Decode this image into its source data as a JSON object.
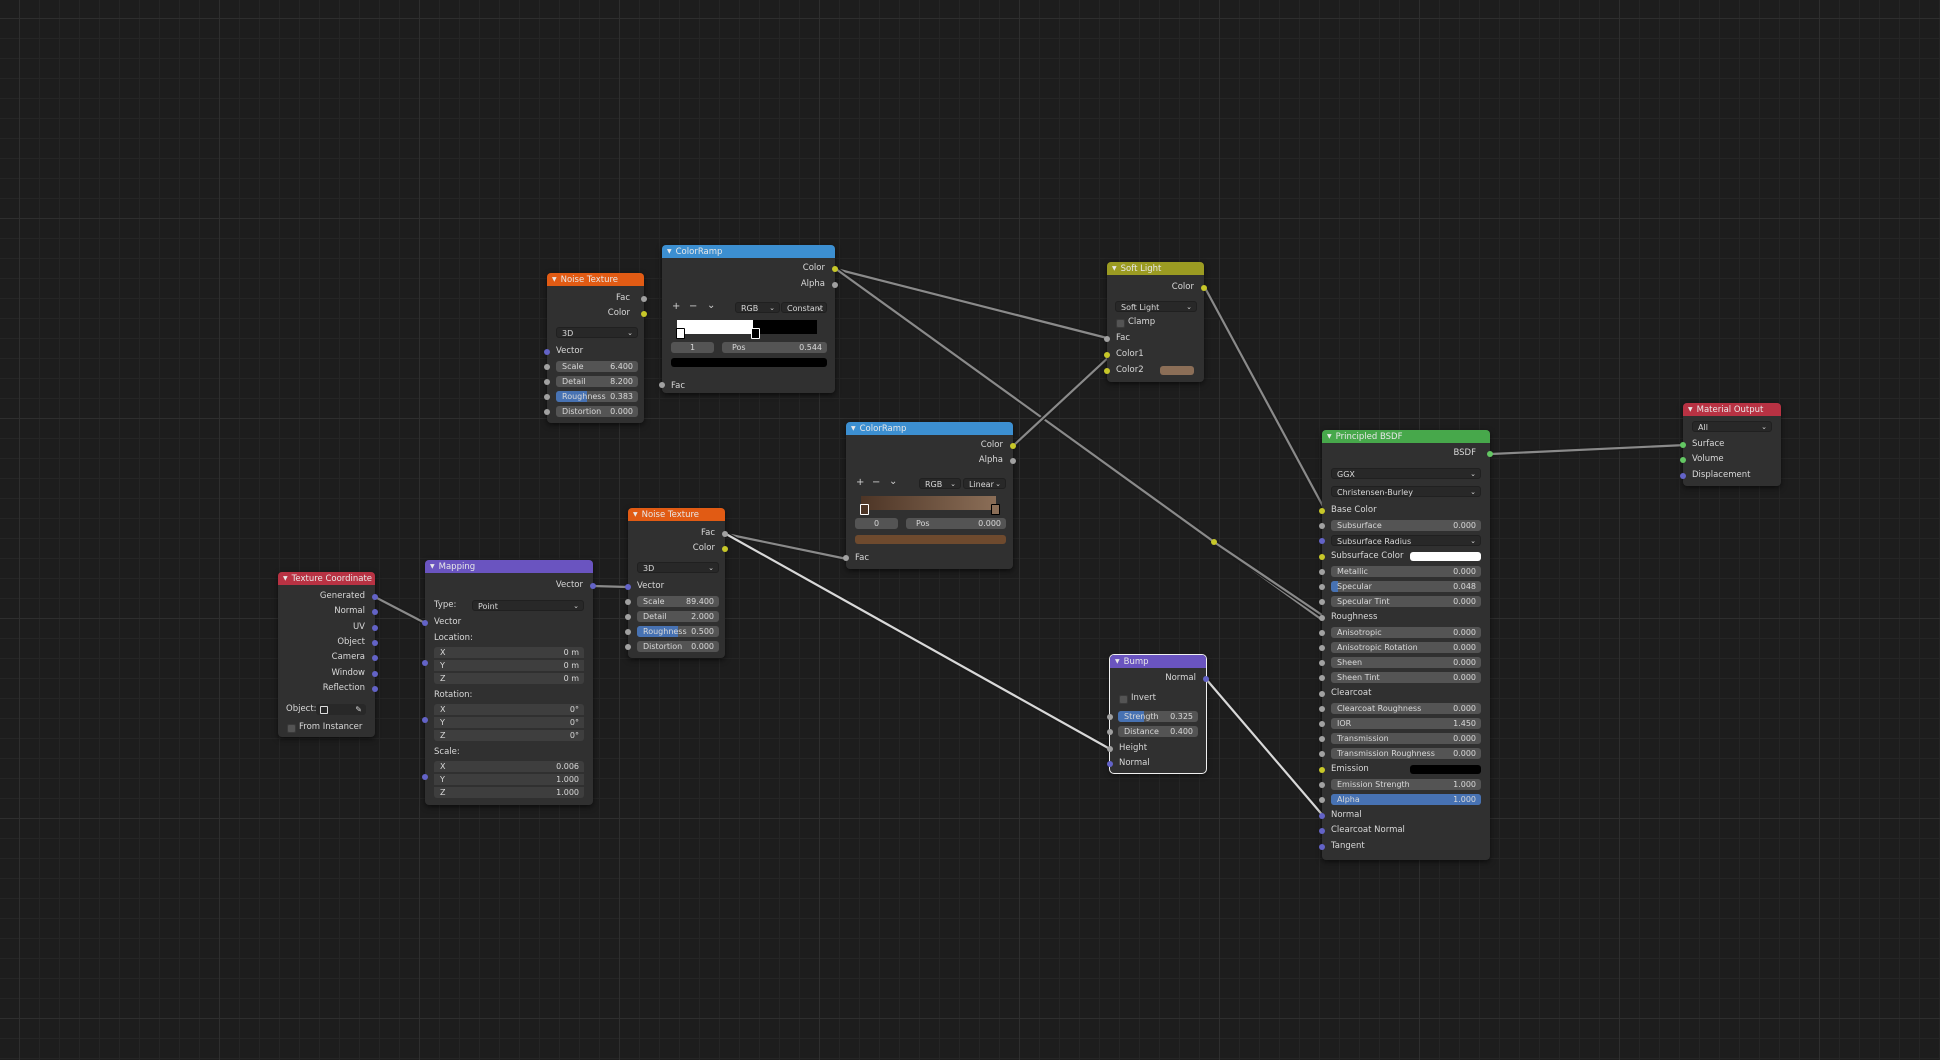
{
  "colors": {
    "header_texture": "#e15b14",
    "header_converter": "#3c8fd1",
    "header_vector": "#6a54c0",
    "header_input": "#b83243",
    "header_color": "#9b9b22",
    "header_shader": "#47a84b",
    "header_output": "#b83243",
    "accent": "#4772b3",
    "soft_light_color2": "#8b6e57",
    "ramp2_left": "#4d3526",
    "ramp2_right": "#8b6e57",
    "ramp2_output": "#6e4a2e"
  },
  "noise1": {
    "title": "Noise Texture",
    "out_fac": "Fac",
    "out_color": "Color",
    "dim": "3D",
    "in_vector": "Vector",
    "scale_label": "Scale",
    "scale_value": "6.400",
    "detail_label": "Detail",
    "detail_value": "8.200",
    "rough_label": "Roughness",
    "rough_value": "0.383",
    "rough_fill": 0.383,
    "dist_label": "Distortion",
    "dist_value": "0.000"
  },
  "ramp1": {
    "title": "ColorRamp",
    "out_color": "Color",
    "out_alpha": "Alpha",
    "add": "+",
    "remove": "−",
    "menu": "⌄",
    "mode": "RGB",
    "interp": "Constant",
    "index": "1",
    "pos_label": "Pos",
    "pos_value": "0.544",
    "in_fac": "Fac"
  },
  "ramp2": {
    "title": "ColorRamp",
    "out_color": "Color",
    "out_alpha": "Alpha",
    "add": "+",
    "remove": "−",
    "menu": "⌄",
    "mode": "RGB",
    "interp": "Linear",
    "index": "0",
    "pos_label": "Pos",
    "pos_value": "0.000",
    "in_fac": "Fac"
  },
  "noise2": {
    "title": "Noise Texture",
    "out_fac": "Fac",
    "out_color": "Color",
    "dim": "3D",
    "in_vector": "Vector",
    "scale_label": "Scale",
    "scale_value": "89.400",
    "detail_label": "Detail",
    "detail_value": "2.000",
    "rough_label": "Roughness",
    "rough_value": "0.500",
    "rough_fill": 0.5,
    "dist_label": "Distortion",
    "dist_value": "0.000"
  },
  "texcoord": {
    "title": "Texture Coordinate",
    "outputs": [
      "Generated",
      "Normal",
      "UV",
      "Object",
      "Camera",
      "Window",
      "Reflection"
    ],
    "object_label": "Object:",
    "from_instancer": "From Instancer"
  },
  "mapping": {
    "title": "Mapping",
    "out_vector": "Vector",
    "type_label": "Type:",
    "type_value": "Point",
    "in_vector": "Vector",
    "location_label": "Location:",
    "loc": [
      {
        "k": "X",
        "v": "0 m"
      },
      {
        "k": "Y",
        "v": "0 m"
      },
      {
        "k": "Z",
        "v": "0 m"
      }
    ],
    "rotation_label": "Rotation:",
    "rot": [
      {
        "k": "X",
        "v": "0°"
      },
      {
        "k": "Y",
        "v": "0°"
      },
      {
        "k": "Z",
        "v": "0°"
      }
    ],
    "scale_label": "Scale:",
    "scl": [
      {
        "k": "X",
        "v": "0.006"
      },
      {
        "k": "Y",
        "v": "1.000"
      },
      {
        "k": "Z",
        "v": "1.000"
      }
    ]
  },
  "softlight": {
    "title": "Soft Light",
    "out_color": "Color",
    "blend": "Soft Light",
    "clamp": "Clamp",
    "in_fac": "Fac",
    "in_color1": "Color1",
    "in_color2": "Color2"
  },
  "bump": {
    "title": "Bump",
    "out_normal": "Normal",
    "invert": "Invert",
    "strength_label": "Strength",
    "strength_value": "0.325",
    "strength_fill": 0.325,
    "distance_label": "Distance",
    "distance_value": "0.400",
    "in_height": "Height",
    "in_normal": "Normal"
  },
  "bsdf": {
    "title": "Principled BSDF",
    "out_bsdf": "BSDF",
    "distribution": "GGX",
    "subsurface_method": "Christensen-Burley",
    "base_color": "Base Color",
    "subsurface_label": "Subsurface",
    "subsurface_value": "0.000",
    "subsurface_radius": "Subsurface Radius",
    "subsurface_color": "Subsurface Color",
    "metallic_label": "Metallic",
    "metallic_value": "0.000",
    "specular_label": "Specular",
    "specular_value": "0.048",
    "specular_fill": 0.048,
    "specular_tint_label": "Specular Tint",
    "specular_tint_value": "0.000",
    "roughness": "Roughness",
    "aniso_label": "Anisotropic",
    "aniso_value": "0.000",
    "aniso_rot_label": "Anisotropic Rotation",
    "aniso_rot_value": "0.000",
    "sheen_label": "Sheen",
    "sheen_value": "0.000",
    "sheen_tint_label": "Sheen Tint",
    "sheen_tint_value": "0.000",
    "clearcoat": "Clearcoat",
    "cc_rough_label": "Clearcoat Roughness",
    "cc_rough_value": "0.000",
    "ior_label": "IOR",
    "ior_value": "1.450",
    "trans_label": "Transmission",
    "trans_value": "0.000",
    "trans_rough_label": "Transmission Roughness",
    "trans_rough_value": "0.000",
    "emission": "Emission",
    "emis_strength_label": "Emission Strength",
    "emis_strength_value": "1.000",
    "alpha_label": "Alpha",
    "alpha_value": "1.000",
    "alpha_fill": 1.0,
    "normal": "Normal",
    "cc_normal": "Clearcoat Normal",
    "tangent": "Tangent"
  },
  "output": {
    "title": "Material Output",
    "target": "All",
    "surface": "Surface",
    "volume": "Volume",
    "displacement": "Displacement"
  }
}
